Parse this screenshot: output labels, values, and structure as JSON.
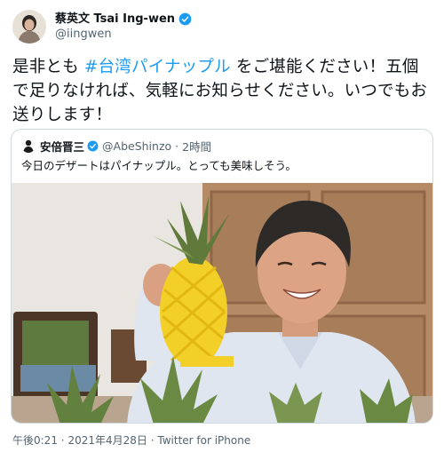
{
  "author": {
    "name": "蔡英文 Tsai Ing-wen",
    "handle": "@iingwen"
  },
  "tweet": {
    "text_before": "是非とも ",
    "hashtag": "#台湾パイナップル",
    "text_after": " をご堪能ください！五個で足りなければ、気軽にお知らせください。いつでもお送りします！"
  },
  "quoted": {
    "name": "安倍晋三",
    "handle": "@AbeShinzo",
    "separator": "·",
    "time": "2時間",
    "text": "今日のデザートはパイナップル。とっても美味しそう。"
  },
  "footer": {
    "time": "午後0:21",
    "dot1": "·",
    "date": "2021年4月28日",
    "dot2": "·",
    "source": "Twitter for iPhone"
  },
  "colors": {
    "accent": "#1d9bf0",
    "text": "#0f1419",
    "muted": "#536471",
    "border": "#cfd9de"
  }
}
